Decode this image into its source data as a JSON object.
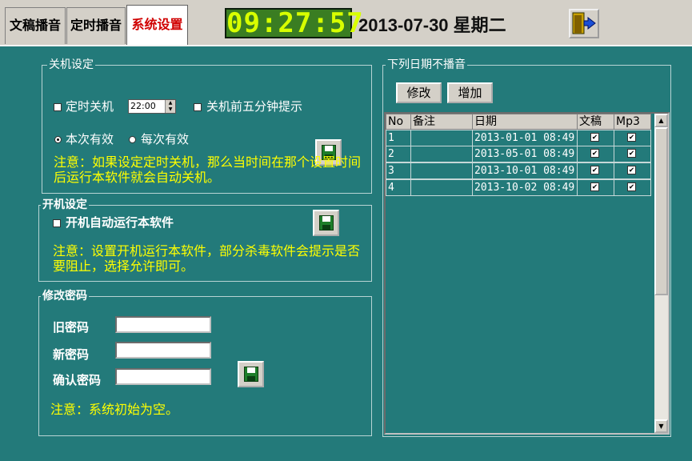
{
  "tabs": [
    {
      "label": "文稿播音"
    },
    {
      "label": "定时播音"
    },
    {
      "label": "系统设置"
    }
  ],
  "clock": "09:27:57",
  "date_text": "2013-07-30 星期二",
  "shutdown": {
    "title": "关机设定",
    "timed_label": "定时关机",
    "time_value": "22:00",
    "warn_label": "关机前五分钟提示",
    "once_label": "本次有效",
    "every_label": "每次有效",
    "note": "注意：如果设定定时关机，那么当时间在那个设置时间后运行本软件就会自动关机。"
  },
  "startup": {
    "title": "开机设定",
    "autorun_label": "开机自动运行本软件",
    "note": "注意：设置开机运行本软件，部分杀毒软件会提示是否要阻止，选择允许即可。"
  },
  "password": {
    "title": "修改密码",
    "old_label": "旧密码",
    "new_label": "新密码",
    "confirm_label": "确认密码",
    "note": "注意：系统初始为空。"
  },
  "no_broadcast": {
    "title": "下列日期不播音",
    "edit_label": "修改",
    "add_label": "增加",
    "columns": [
      "No",
      "备注",
      "日期",
      "文稿",
      "Mp3"
    ],
    "rows": [
      {
        "no": "1",
        "note": "",
        "date": "2013-01-01 08:49",
        "doc": true,
        "mp3": true
      },
      {
        "no": "2",
        "note": "",
        "date": "2013-05-01 08:49",
        "doc": true,
        "mp3": true
      },
      {
        "no": "3",
        "note": "",
        "date": "2013-10-01 08:49",
        "doc": true,
        "mp3": true
      },
      {
        "no": "4",
        "note": "",
        "date": "2013-10-02 08:49",
        "doc": true,
        "mp3": true
      }
    ]
  },
  "colors": {
    "background": "#237a7a",
    "note_text": "#ffff00",
    "clock_digits": "#d8ff00",
    "active_tab_text": "#d00000"
  },
  "icons": {
    "save": "floppy-disk-icon",
    "exit": "exit-door-icon",
    "check": "✔"
  }
}
